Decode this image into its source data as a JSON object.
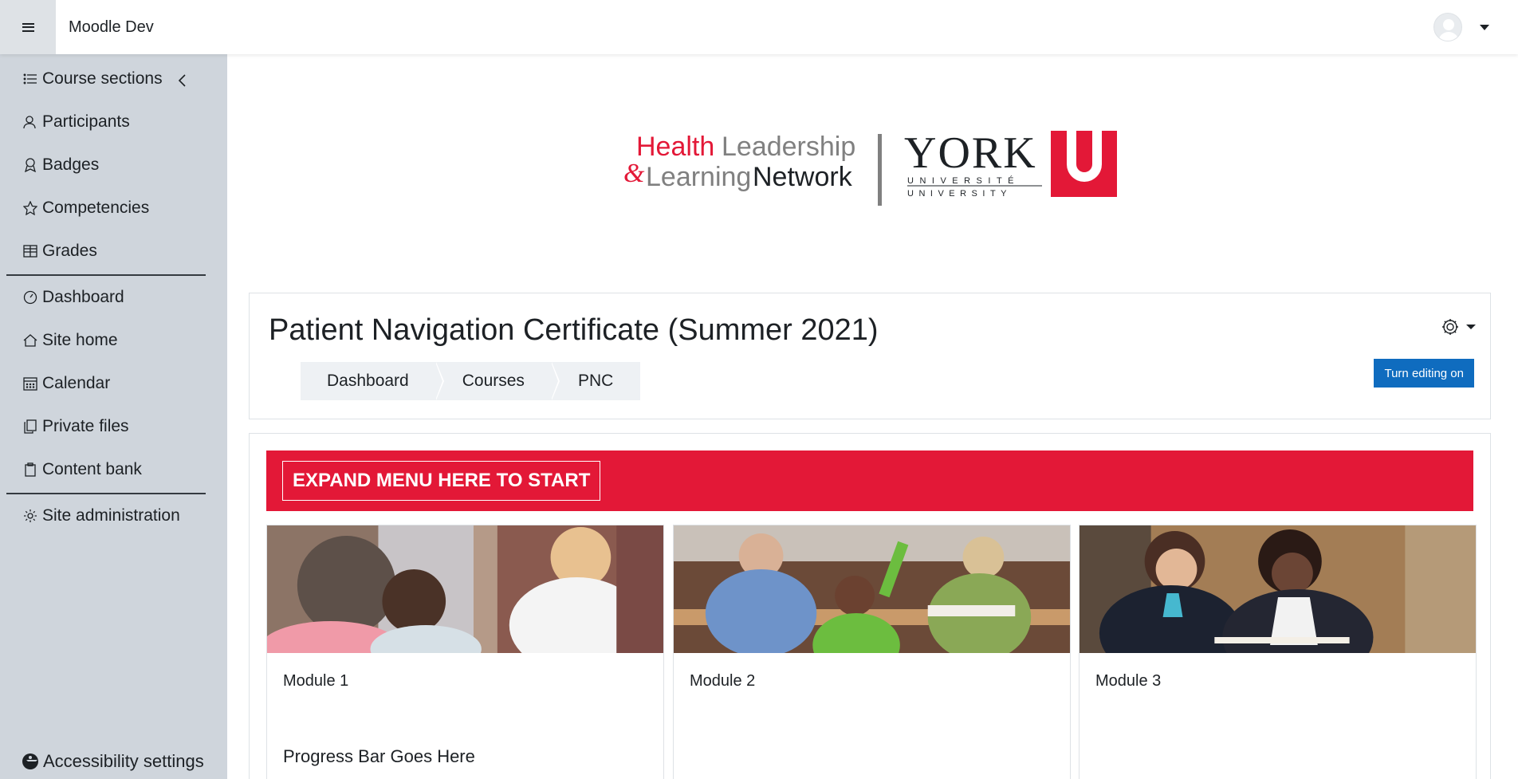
{
  "navbar": {
    "site_name": "Moodle Dev"
  },
  "sidebar": {
    "course_items": [
      {
        "label": "Course sections",
        "icon": "list-icon"
      },
      {
        "label": "Participants",
        "icon": "users-icon"
      },
      {
        "label": "Badges",
        "icon": "award-icon"
      },
      {
        "label": "Competencies",
        "icon": "star-icon"
      },
      {
        "label": "Grades",
        "icon": "table-icon"
      }
    ],
    "site_items": [
      {
        "label": "Dashboard",
        "icon": "dashboard-icon"
      },
      {
        "label": "Site home",
        "icon": "home-icon"
      },
      {
        "label": "Calendar",
        "icon": "calendar-icon"
      },
      {
        "label": "Private files",
        "icon": "file-icon"
      },
      {
        "label": "Content bank",
        "icon": "clipboard-icon"
      }
    ],
    "admin_item": {
      "label": "Site administration",
      "icon": "gear-icon"
    },
    "accessibility": "Accessibility settings"
  },
  "logo": {
    "health": "Health",
    "leadership": "Leadership",
    "amp": "&",
    "learning": "Learning",
    "network": "Network",
    "york": "YORK",
    "universite": "UNIVERSITÉ",
    "university": "UNIVERSITY",
    "colors": {
      "red": "#e31837",
      "gray": "#808080"
    }
  },
  "course": {
    "title": "Patient Navigation Certificate (Summer 2021)",
    "breadcrumb": [
      "Dashboard",
      "Courses",
      "PNC"
    ],
    "edit_button": "Turn editing on"
  },
  "banner": {
    "label": "EXPAND MENU HERE TO START",
    "color": "#e31837"
  },
  "modules": [
    {
      "title": "Module 1",
      "progress": "Progress Bar Goes Here"
    },
    {
      "title": "Module 2",
      "progress": ""
    },
    {
      "title": "Module 3",
      "progress": ""
    }
  ],
  "colors": {
    "primary": "#0f6cbf",
    "sidebar_bg": "#cfd5dc"
  }
}
